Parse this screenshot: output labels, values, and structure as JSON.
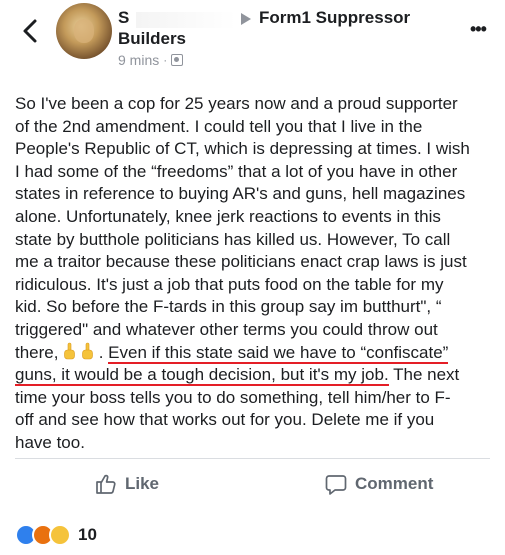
{
  "header": {
    "name_line1": "S",
    "name_line2": "Builders",
    "group_name": "Form1 Suppressor",
    "timestamp": "9 mins",
    "separator": "·",
    "more_label": "•••"
  },
  "post": {
    "lines": [
      "So I've been a cop for 25 years now and a proud supporter",
      "of the 2nd amendment. I could tell you that I live in the",
      "People's Republic of CT, which is depressing at times. I wish",
      "I had some of the “freedoms” that a lot of you have in other",
      "states in reference to buying AR's and guns, hell magazines",
      "alone. Unfortunately, knee jerk reactions to events in this",
      "state by butthole politicians has killed us. However, To call",
      "me a traitor because these politicians enact crap laws is just",
      "ridiculous. It's just a job that puts food on the table for my",
      "kid. So before the F-tards in this group say im butthurt\", “",
      "triggered\" and whatever other terms you could throw out"
    ],
    "line12_start": "there,",
    "line12_after_emoji": ".",
    "line12_highlight": "Even if this state said we have to “confiscate”",
    "line13_highlight": "guns, it would be a tough decision, but it's my job.",
    "line13_rest": " The next",
    "lines_end": [
      "time your boss tells you to do something, tell him/her to F-",
      "off and see how that works out for you. Delete me if you",
      "have too."
    ]
  },
  "actions": {
    "like_label": "Like",
    "comment_label": "Comment"
  },
  "reactions": {
    "count": "10"
  },
  "colors": {
    "highlight_underline": "#e41e26",
    "like_reaction": "#2f80ed",
    "angry_reaction": "#e9710f",
    "haha_reaction": "#f5c33b"
  }
}
